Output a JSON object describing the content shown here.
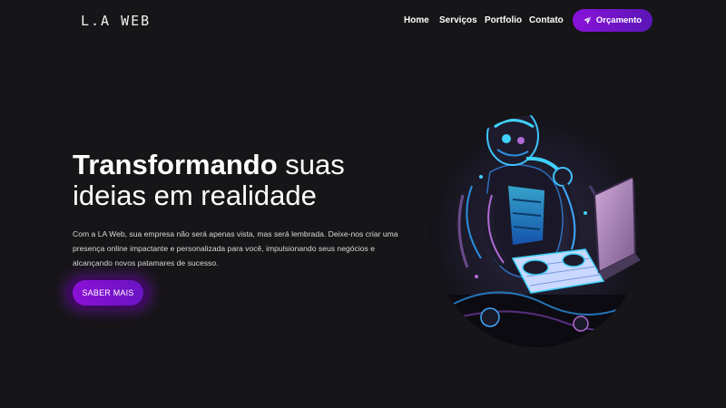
{
  "header": {
    "logo": "L.A WEB",
    "nav": [
      {
        "label": "Home"
      },
      {
        "label": "Serviços"
      },
      {
        "label": "Portfolio"
      },
      {
        "label": "Contato"
      }
    ],
    "cta": {
      "label": "Orçamento",
      "icon": "paper-plane-icon"
    }
  },
  "hero": {
    "title_strong": "Transformando",
    "title_rest_1": "suas",
    "title_rest_2": "ideias em realidade",
    "description": "Com a LA Web, sua empresa não será apenas vista, mas será lembrada. Deixe-nos criar uma presença online impactante e personalizada para você, impulsionando seus negócios e alcançando novos patamares de sucesso.",
    "button": "SABER MAIS",
    "image": "robot-typing-on-laptop"
  },
  "colors": {
    "background": "#161517",
    "accent": "#8a12d8",
    "accent_dark": "#5a16b8",
    "neon": "#22b8ff"
  }
}
